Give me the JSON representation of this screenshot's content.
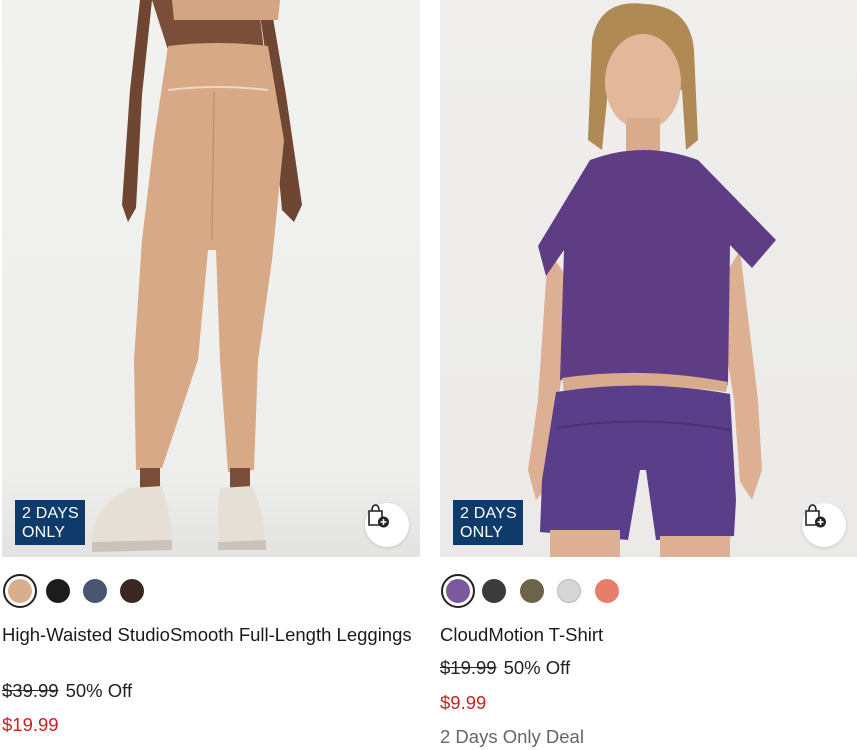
{
  "products": [
    {
      "badge_line1": "2 DAYS",
      "badge_line2": "ONLY",
      "name": "High-Waisted StudioSmooth Full-Length Leggings",
      "was_price": "$39.99",
      "discount": "50% Off",
      "price": "$19.99",
      "swatches": [
        {
          "color": "#d9ad8e",
          "selected": true
        },
        {
          "color": "#1c1c1c",
          "selected": false
        },
        {
          "color": "#4a5570",
          "selected": false
        },
        {
          "color": "#3a2622",
          "selected": false
        }
      ],
      "bag_icon": "add-to-bag-icon"
    },
    {
      "badge_line1": "2 DAYS",
      "badge_line2": "ONLY",
      "name": "CloudMotion T-Shirt",
      "was_price": "$19.99",
      "discount": "50% Off",
      "price": "$9.99",
      "deal": "2 Days Only Deal",
      "swatches": [
        {
          "color": "#7a5a9c",
          "selected": true
        },
        {
          "color": "#3b3b3b",
          "selected": false
        },
        {
          "color": "#6b644a",
          "selected": false
        },
        {
          "color": "#d6d6d6",
          "selected": false
        },
        {
          "color": "#e57f6c",
          "selected": false
        }
      ],
      "bag_icon": "add-to-bag-icon"
    }
  ],
  "colors": {
    "badge_bg": "#0f3b6b",
    "sale_price": "#cc1f1f",
    "deal_text": "#666666"
  }
}
